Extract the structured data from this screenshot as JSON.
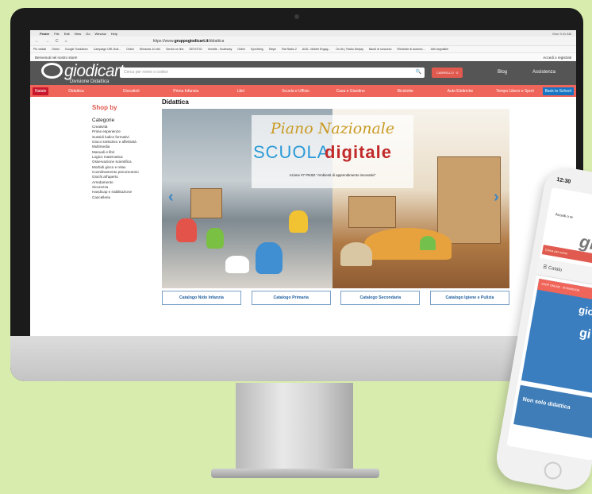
{
  "mac": {
    "menubar": {
      "apple": "",
      "app": "Finder",
      "items": [
        "File",
        "Edit",
        "View",
        "Go",
        "Window",
        "Help"
      ],
      "clock": "Mon 9:41 AM"
    },
    "browser": {
      "url_prefix": "https://www.",
      "url_domain": "gruppogiodicart.it",
      "url_path": "/didattica",
      "nav_back": "←",
      "nav_forward": "→",
      "reload": "C",
      "home": "⌂"
    },
    "bookmarks": [
      "Più visitati",
      "Ordini",
      "Google Traduttore",
      "Campaign URL Buil...",
      "Ordini",
      "Windows 10 x64",
      "Servizi on line",
      "DEVOTIO",
      "Vendite - Scaleway",
      "Ordini",
      "Syncthing",
      "Stripe",
      "Rai Radio 2",
      "AGA - Mobile Engag...",
      "On Air | Radio Deejay",
      "Bandi di concorso",
      "Richieste di autorizz...",
      "Altri segnalibri"
    ]
  },
  "site": {
    "welcome": "Benvenuti nel nostro store!",
    "login": "Accedi o registrati",
    "logo_name": "giodicart",
    "logo_sub": "Divisione Didattica",
    "search_placeholder": "Cerca per nome o codice",
    "search_icon": "🔍",
    "cart": "CARRELLO",
    "cart_count": "0",
    "blog": "Blog",
    "assistenza": "Assistenza",
    "categories_nav": [
      "Natale",
      "Didattica",
      "Giocattoli",
      "Prima Infanzia",
      "Libri",
      "Scuola e Ufficio",
      "Casa e Giardino",
      "Biciclette",
      "Auto Elettriche",
      "Tempo Libero e Sport",
      "Back to School"
    ],
    "shop_by": "Shop by",
    "categorie_title": "Categorie",
    "categorie": [
      "Creatività",
      "Prime esperienze",
      "Sussidi ludico formativi",
      "Gioco simbolico e affettività",
      "Multimedia",
      "Manuali e libri",
      "Logico matematica",
      "Osservazione scientifica",
      "Morbidi gioco e relax",
      "Coordinamento psicomotorio",
      "Giochi all'aperto",
      "Arredamento",
      "Sicurezza",
      "Handicap e riabilitazione",
      "Cancelleria"
    ],
    "page_title": "Didattica",
    "hero": {
      "line1": "Piano Nazionale",
      "scuola": "SCUOLA",
      "digitale": "digitale",
      "azione": "Azione #7 PNSD \"Ambienti di apprendimento innovativi\"",
      "prev": "‹",
      "next": "›"
    },
    "catalog_buttons": [
      "Catalogo Nido Infanzia",
      "Catalogo Primaria",
      "Catalogo Secondaria",
      "Catalogo Igiene e Pulizia"
    ],
    "chat": "Lasc"
  },
  "phone": {
    "time": "12:30",
    "accedi": "Accedi o re",
    "logo": "gi",
    "search": "Cerca per nome",
    "menu_label": "Catalo",
    "card_top": "SHOP ONLINE · SHOWROOM",
    "card_logo1": "giodic",
    "card_logo2": "gi",
    "non_solo": "Non solo didattica"
  }
}
